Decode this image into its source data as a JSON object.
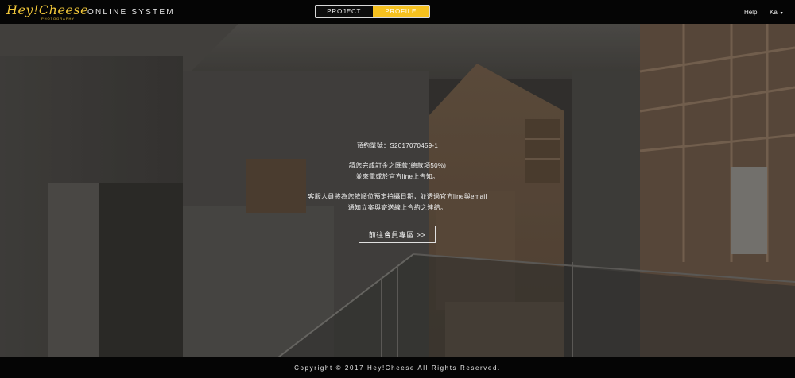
{
  "header": {
    "logo_text": "Hey!Cheese",
    "logo_subtext": "PHOTOGRAPHY",
    "system_title": "ONLINE SYSTEM",
    "tabs": [
      {
        "label": "PROJECT",
        "active": false
      },
      {
        "label": "PROFILE",
        "active": true
      }
    ],
    "help_label": "Help",
    "user_name": "Kai",
    "user_caret": "▾",
    "accent_color": "#f6c11f"
  },
  "main": {
    "order_line": "預約單號：S2017070459-1",
    "deposit_line1": "請您完成訂金之匯款(總款項50%)",
    "deposit_line2": "並來電或於官方line上告知。",
    "service_line1": "客服人員將為您依順位預定拍攝日期，並透過官方line與email",
    "service_line2": "通知立案與寄送線上合約之連結。",
    "member_button": "前往會員專區 >>"
  },
  "footer": {
    "copyright": "Copyright © 2017 Hey!Cheese All Rights Reserved."
  }
}
